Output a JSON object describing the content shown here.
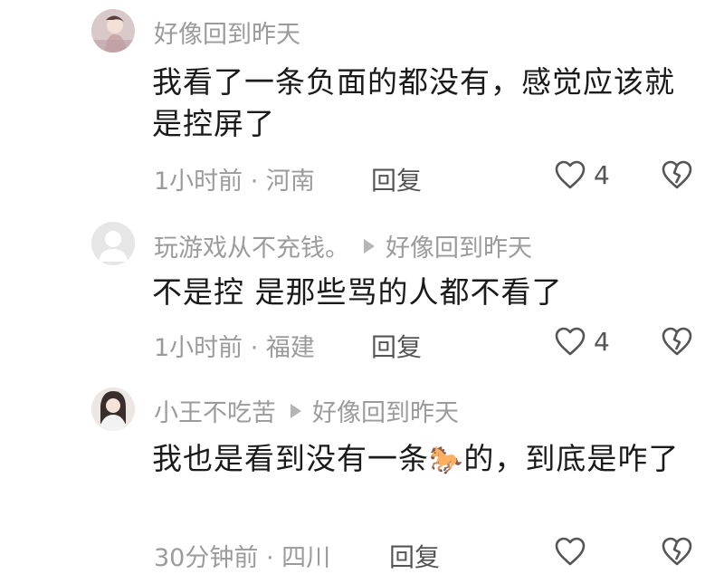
{
  "comments": [
    {
      "username": "好像回到昨天",
      "reply_to": "",
      "text": "我看了一条负面的都没有，感觉应该就是控屏了",
      "time": "1小时前 · 河南",
      "reply_label": "回复",
      "likes": "4"
    },
    {
      "username": "玩游戏从不充钱。",
      "reply_to": "好像回到昨天",
      "text": "不是控 是那些骂的人都不看了",
      "time": "1小时前 · 福建",
      "reply_label": "回复",
      "likes": "4"
    },
    {
      "username": "小王不吃苦",
      "reply_to": "好像回到昨天",
      "text_before": "我也是看到没有一条",
      "emoji": "🐎",
      "text_after": "的，到底是咋了",
      "time": "30分钟前 · 四川",
      "reply_label": "回复",
      "likes": ""
    }
  ],
  "icons": {
    "like": "heart-outline-icon",
    "dislike": "broken-heart-icon",
    "reply_arrow": "play-triangle-icon"
  }
}
